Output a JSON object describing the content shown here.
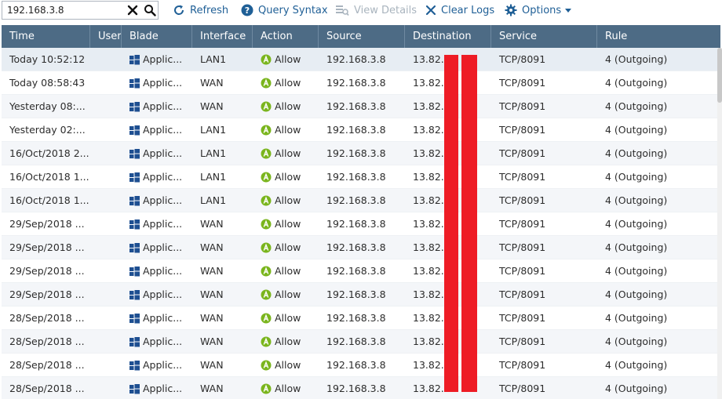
{
  "search": {
    "value": "192.168.3.8",
    "placeholder": ""
  },
  "toolbar": {
    "refresh_label": "Refresh",
    "query_label": "Query Syntax",
    "view_label": "View Details",
    "clear_label": "Clear Logs",
    "options_label": "Options"
  },
  "columns": {
    "time": "Time",
    "user": "User",
    "blade": "Blade",
    "interface": "Interface",
    "action": "Action",
    "source": "Source",
    "destination": "Destination",
    "service": "Service",
    "rule": "Rule"
  },
  "rows": [
    {
      "time": "Today 10:52:12",
      "blade": "Applic...",
      "interface": "LAN1",
      "action": "Allow",
      "source": "192.168.3.8",
      "destination": "13.82.",
      "service": "TCP/8091",
      "rule": "4 (Outgoing)"
    },
    {
      "time": "Today 08:58:43",
      "blade": "Applic...",
      "interface": "WAN",
      "action": "Allow",
      "source": "192.168.3.8",
      "destination": "13.82.",
      "service": "TCP/8091",
      "rule": "4 (Outgoing)"
    },
    {
      "time": "Yesterday 08:...",
      "blade": "Applic...",
      "interface": "WAN",
      "action": "Allow",
      "source": "192.168.3.8",
      "destination": "13.82.",
      "service": "TCP/8091",
      "rule": "4 (Outgoing)"
    },
    {
      "time": "Yesterday 02:...",
      "blade": "Applic...",
      "interface": "LAN1",
      "action": "Allow",
      "source": "192.168.3.8",
      "destination": "13.82.",
      "service": "TCP/8091",
      "rule": "4 (Outgoing)"
    },
    {
      "time": "16/Oct/2018 2...",
      "blade": "Applic...",
      "interface": "LAN1",
      "action": "Allow",
      "source": "192.168.3.8",
      "destination": "13.82.",
      "service": "TCP/8091",
      "rule": "4 (Outgoing)"
    },
    {
      "time": "16/Oct/2018 1...",
      "blade": "Applic...",
      "interface": "LAN1",
      "action": "Allow",
      "source": "192.168.3.8",
      "destination": "13.82.",
      "service": "TCP/8091",
      "rule": "4 (Outgoing)"
    },
    {
      "time": "16/Oct/2018 1...",
      "blade": "Applic...",
      "interface": "LAN1",
      "action": "Allow",
      "source": "192.168.3.8",
      "destination": "13.82.",
      "service": "TCP/8091",
      "rule": "4 (Outgoing)"
    },
    {
      "time": "29/Sep/2018 ...",
      "blade": "Applic...",
      "interface": "WAN",
      "action": "Allow",
      "source": "192.168.3.8",
      "destination": "13.82.",
      "service": "TCP/8091",
      "rule": "4 (Outgoing)"
    },
    {
      "time": "29/Sep/2018 ...",
      "blade": "Applic...",
      "interface": "WAN",
      "action": "Allow",
      "source": "192.168.3.8",
      "destination": "13.82.",
      "service": "TCP/8091",
      "rule": "4 (Outgoing)"
    },
    {
      "time": "29/Sep/2018 ...",
      "blade": "Applic...",
      "interface": "WAN",
      "action": "Allow",
      "source": "192.168.3.8",
      "destination": "13.82.",
      "service": "TCP/8091",
      "rule": "4 (Outgoing)"
    },
    {
      "time": "29/Sep/2018 ...",
      "blade": "Applic...",
      "interface": "WAN",
      "action": "Allow",
      "source": "192.168.3.8",
      "destination": "13.82.",
      "service": "TCP/8091",
      "rule": "4 (Outgoing)"
    },
    {
      "time": "28/Sep/2018 ...",
      "blade": "Applic...",
      "interface": "WAN",
      "action": "Allow",
      "source": "192.168.3.8",
      "destination": "13.82.",
      "service": "TCP/8091",
      "rule": "4 (Outgoing)"
    },
    {
      "time": "28/Sep/2018 ...",
      "blade": "Applic...",
      "interface": "WAN",
      "action": "Allow",
      "source": "192.168.3.8",
      "destination": "13.82.",
      "service": "TCP/8091",
      "rule": "4 (Outgoing)"
    },
    {
      "time": "28/Sep/2018 ...",
      "blade": "Applic...",
      "interface": "WAN",
      "action": "Allow",
      "source": "192.168.3.8",
      "destination": "13.82.",
      "service": "TCP/8091",
      "rule": "4 (Outgoing)"
    },
    {
      "time": "28/Sep/2018 ...",
      "blade": "Applic...",
      "interface": "WAN",
      "action": "Allow",
      "source": "192.168.3.8",
      "destination": "13.82.",
      "service": "TCP/8091",
      "rule": "4 (Outgoing)"
    }
  ],
  "icons": {
    "blade": "application-blade-icon",
    "action_allow": "allow-icon",
    "refresh": "refresh-icon",
    "query": "help-icon",
    "view": "view-details-icon",
    "clear": "close-icon",
    "options": "gear-icon"
  },
  "colors": {
    "header_bg": "#4d6b85",
    "toolbar_text": "#1f5f96",
    "allow_green": "#7ab51d",
    "blade_blue": "#1e4f91",
    "redaction": "#ee1c25"
  }
}
